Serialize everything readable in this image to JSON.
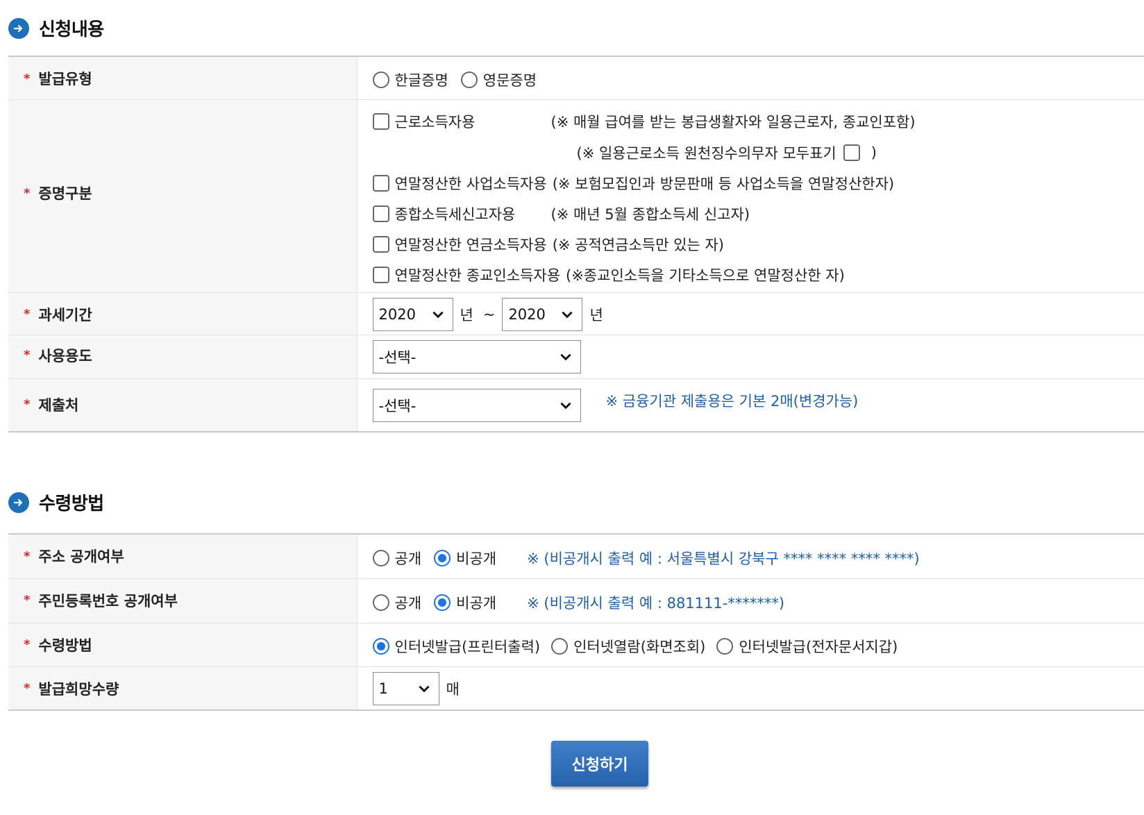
{
  "section1": {
    "title": "신청내용"
  },
  "issue_type": {
    "label": "발급유형",
    "options": [
      "한글증명",
      "영문증명"
    ]
  },
  "cert_type": {
    "label": "증명구분",
    "earned": {
      "label": "근로소득자용",
      "note": "(※ 매월 급여를 받는 봉급생활자와 일용근로자, 종교인포함)"
    },
    "daily_note_open": "(※ 일용근로소득 원천징수의무자 모두표기",
    "daily_note_close": ")",
    "business": {
      "label": "연말정산한 사업소득자용",
      "note": "(※ 보험모집인과 방문판매 등 사업소득을 연말정산한자)"
    },
    "comprehensive": {
      "label": "종합소득세신고자용",
      "note": "(※ 매년 5월 종합소득세 신고자)"
    },
    "pension": {
      "label": "연말정산한 연금소득자용",
      "note": "(※ 공적연금소득만 있는 자)"
    },
    "religious": {
      "label": "연말정산한 종교인소득자용",
      "note": "(※종교인소득을 기타소득으로 연말정산한 자)"
    }
  },
  "tax_period": {
    "label": "과세기간",
    "from": "2020",
    "to": "2020",
    "unit": "년",
    "tilde": "~"
  },
  "usage": {
    "label": "사용용도",
    "value": "-선택-"
  },
  "submit_to": {
    "label": "제출처",
    "value": "-선택-",
    "note": "※ 금융기관 제출용은 기본 2매(변경가능)"
  },
  "section2": {
    "title": "수령방법"
  },
  "address_public": {
    "label": "주소 공개여부",
    "options": [
      "공개",
      "비공개"
    ],
    "selected": "비공개",
    "note": "※ (비공개시 출력 예 : 서울특별시 강북구 **** **** **** ****)"
  },
  "rrn_public": {
    "label": "주민등록번호 공개여부",
    "options": [
      "공개",
      "비공개"
    ],
    "selected": "비공개",
    "note": "※ (비공개시 출력 예 : 881111-*******)"
  },
  "receive_method": {
    "label": "수령방법",
    "options": [
      "인터넷발급(프린터출력)",
      "인터넷열람(화면조회)",
      "인터넷발급(전자문서지갑)"
    ],
    "selected": "인터넷발급(프린터출력)"
  },
  "quantity": {
    "label": "발급희망수량",
    "value": "1",
    "unit": "매"
  },
  "submit_button": "신청하기",
  "colors": {
    "accent": "#1d6fb8",
    "note": "#1d5fa8",
    "required": "#d9262c",
    "radio_selected": "#1a73e8"
  }
}
